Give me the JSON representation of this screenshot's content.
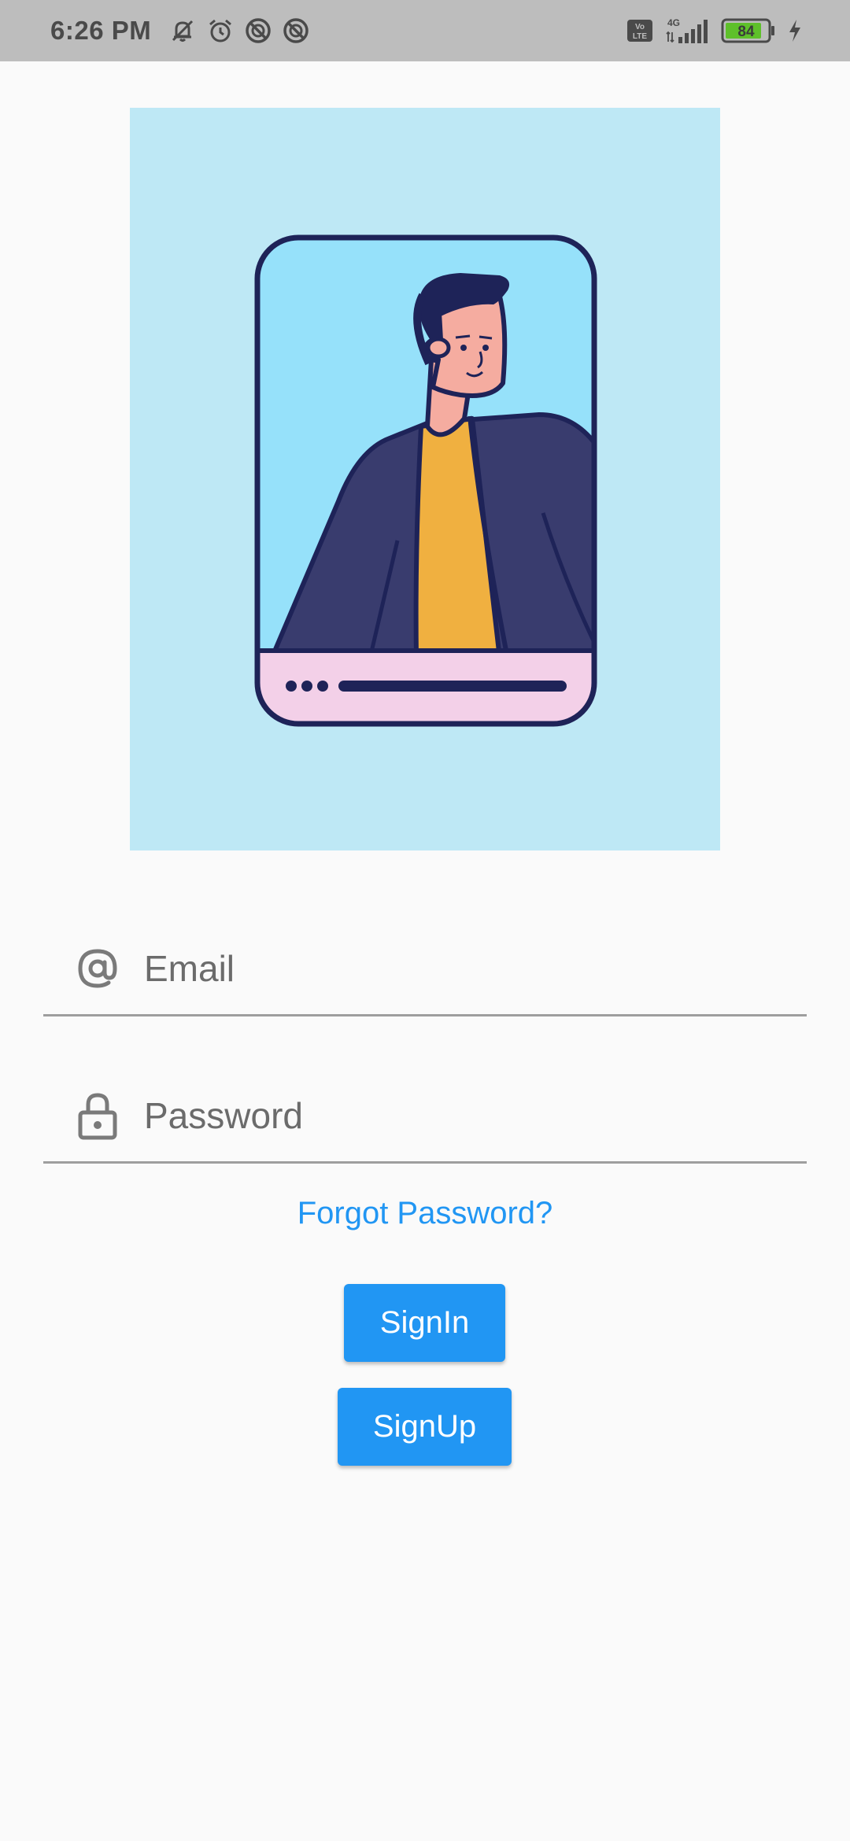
{
  "status_bar": {
    "time": "6:26 PM",
    "network": "4G",
    "volte": "Vo LTE",
    "battery": "84",
    "left_icons": [
      "muted-bell-icon",
      "alarm-icon",
      "blocked-icon",
      "blocked-icon"
    ],
    "right_icons": [
      "volte-icon",
      "signal-icon",
      "battery-icon",
      "charging-icon"
    ]
  },
  "illustration": {
    "description_icon": "person-profile-card-illustration",
    "colors": {
      "background": "#bee8f5",
      "card_sky": "#96e1fa",
      "jacket": "#393c6e",
      "shirt": "#f0b040",
      "skin": "#f5aca0",
      "hair": "#1e2358",
      "footer": "#f3d0e8",
      "outline": "#1e2358"
    }
  },
  "form": {
    "email": {
      "icon": "at-sign-icon",
      "placeholder": "Email",
      "value": ""
    },
    "password": {
      "icon": "lock-icon",
      "placeholder": "Password",
      "value": ""
    },
    "forgot_label": "Forgot Password?"
  },
  "buttons": {
    "signin_label": "SignIn",
    "signup_label": "SignUp"
  },
  "colors": {
    "accent": "#2196f3",
    "status_bar": "#bdbdbd",
    "background": "#fafafa"
  }
}
